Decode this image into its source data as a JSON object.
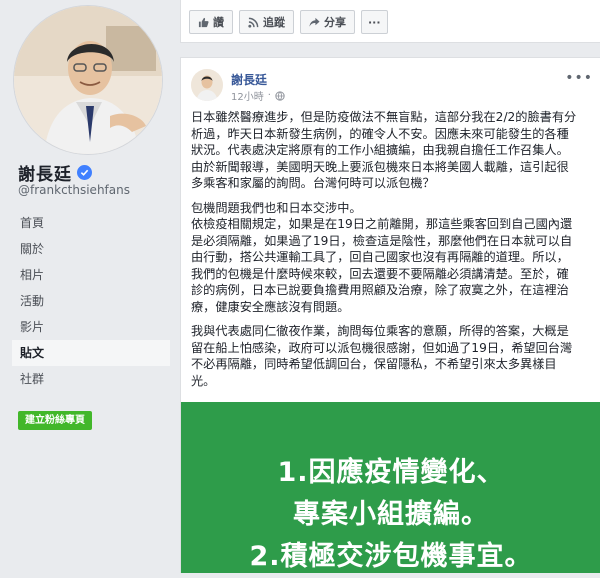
{
  "page": {
    "name": "謝長廷",
    "handle": "@frankcthsiehfans",
    "create_button": "建立粉絲專頁"
  },
  "nav": [
    {
      "label": "首頁",
      "active": false
    },
    {
      "label": "關於",
      "active": false
    },
    {
      "label": "相片",
      "active": false
    },
    {
      "label": "活動",
      "active": false
    },
    {
      "label": "影片",
      "active": false
    },
    {
      "label": "貼文",
      "active": true
    },
    {
      "label": "社群",
      "active": false
    }
  ],
  "top_actions": {
    "like": "讚",
    "follow": "追蹤",
    "share": "分享",
    "more": "···"
  },
  "post": {
    "author": "謝長廷",
    "time": "12小時",
    "paragraphs": [
      [
        "日本雖然醫療進步，但是防疫做法不無盲點，這部分我在2/2的臉書有分",
        "析過，昨天日本新發生病例，的確令人不安。因應未來可能發生的各種",
        "狀況。代表處決定將原有的工作小組擴編，由我親自擔任工作召集人。",
        "由於新聞報導，美國明天晚上要派包機來日本將美國人載離，這引起很",
        "多乘客和家屬的詢問。台灣何時可以派包機？"
      ],
      [
        "包機問題我們也和日本交涉中。",
        "依檢疫相關規定，如果是在19日之前離開，那這些乘客回到自己國內還",
        "是必須隔離，如果過了19日，檢查這是陰性，那麼他們在日本就可以自",
        "由行動，搭公共運輸工具了，回自己國家也沒有再隔離的道理。所以，",
        "我們的包機是什麼時候來較，回去還要不要隔離必須講清楚。至於，確",
        "診的病例，日本已說要負擔費用照顧及治療，除了寂寞之外，在這裡治",
        "療，健康安全應該沒有問題。"
      ],
      [
        "我與代表處同仁徹夜作業，詢問每位乘客的意願，所得的答案，大概是",
        "留在船上怕感染，政府可以派包機很感謝，但如過了19日，希望回台灣",
        "不必再隔離，同時希望低調回台，保留隱私，不希望引來太多異樣目",
        "光。"
      ]
    ],
    "image_lines": [
      "1.因應疫情變化、",
      "專案小組擴編。",
      "2.積極交涉包機事宜。"
    ]
  },
  "colors": {
    "background": "#e9ebee",
    "link": "#385898",
    "create_button": "#42b72a",
    "image_green": "#2e9c4a",
    "verified": "#4080ff"
  }
}
